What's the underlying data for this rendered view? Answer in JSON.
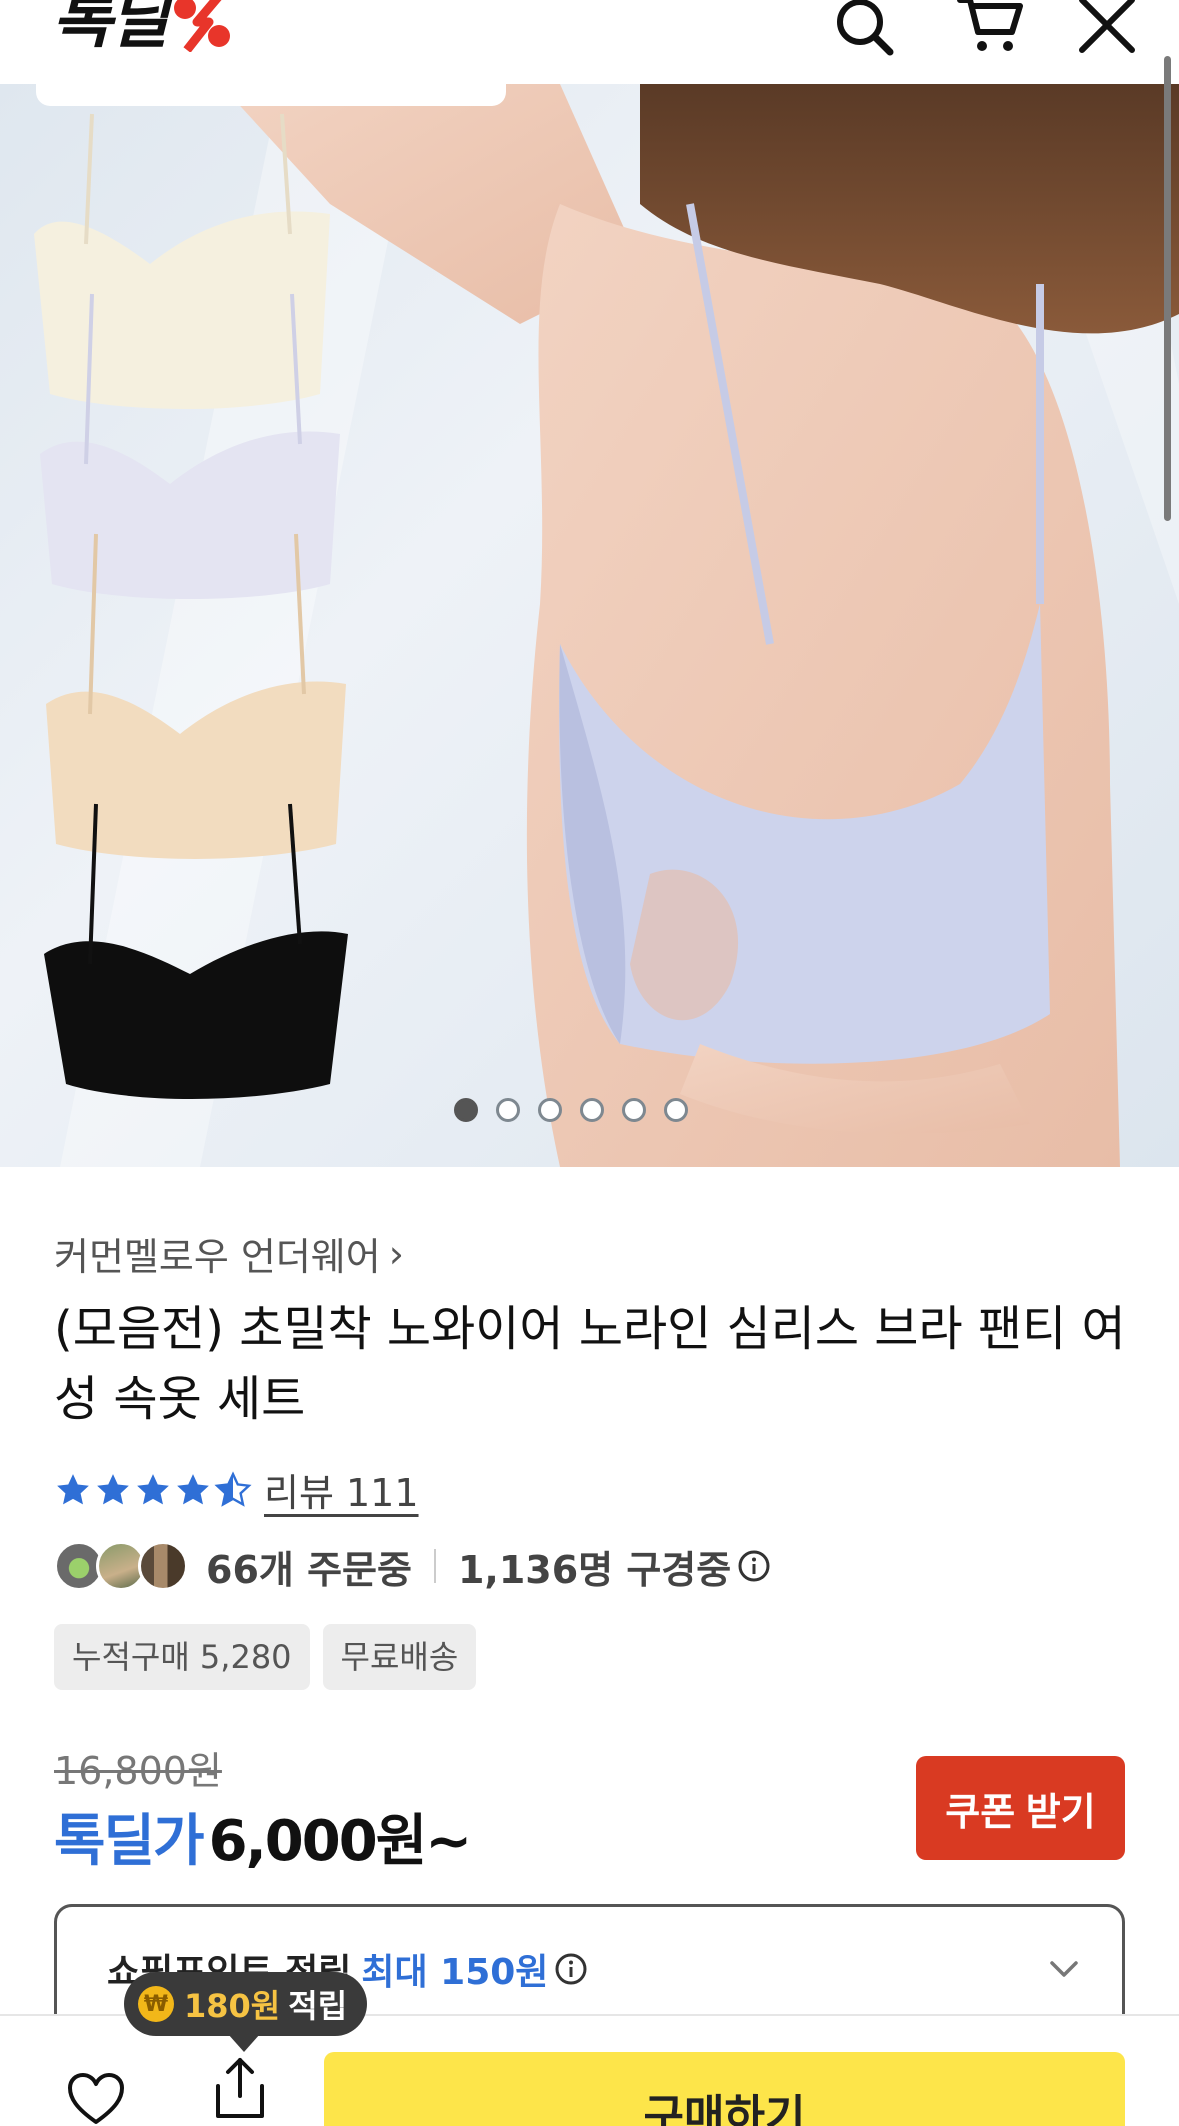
{
  "header": {
    "logo_text": "톡딜",
    "icons": [
      "search-icon",
      "cart-icon",
      "close-icon"
    ]
  },
  "gallery": {
    "dots_total": 6,
    "active_index": 0
  },
  "product": {
    "brand": "커먼멜로우 언더웨어",
    "title": "(모음전) 초밀착 노와이어 노라인 심리스 브라 팬티 여성 속옷 세트",
    "rating": 4.5,
    "review_label": "리뷰 111",
    "orders": "66개 주문중",
    "viewers": "1,136명 구경중",
    "tags": [
      "누적구매 5,280",
      "무료배송"
    ],
    "original_price": "16,800원",
    "deal_label": "톡딜가",
    "deal_price": "6,000원~",
    "coupon_button": "쿠폰 받기",
    "points_label": "쇼핑포인트 적립",
    "points_max": "최대 150원"
  },
  "bottom": {
    "tooltip_amount": "180원",
    "tooltip_label": "적립",
    "coin_symbol": "₩",
    "buy_label": "구매하기"
  },
  "colors": {
    "accent_blue": "#2f6fd6",
    "coupon_red": "#d93a22",
    "buy_yellow": "#fde54a",
    "logo_red": "#e8352a"
  }
}
